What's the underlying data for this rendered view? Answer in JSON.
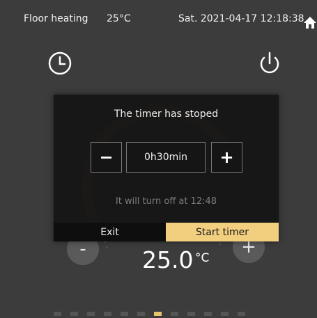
{
  "status_bar": {
    "mode": "Floor heating",
    "room_temp": "25°C",
    "datetime": "Sat. 2021-04-17 12:18:38"
  },
  "icons": {
    "home": "home-icon",
    "clock": "clock-icon",
    "power": "power-icon"
  },
  "controls": {
    "minus_label": "-",
    "plus_label": "+",
    "setpoint_value": "25.0",
    "setpoint_unit": "°C"
  },
  "pager": {
    "count": 12,
    "active_index": 6
  },
  "timer_dialog": {
    "title": "The timer has stoped",
    "decrement_label": "−",
    "increment_label": "+",
    "duration": "0h30min",
    "turn_off_message": "It will turn off at 12:48",
    "exit_label": "Exit",
    "start_label": "Start timer"
  },
  "colors": {
    "background": "#3c3c3c",
    "accent": "#f2cf7f",
    "dialog": "#141414",
    "dial_glow": "#c8833a"
  }
}
